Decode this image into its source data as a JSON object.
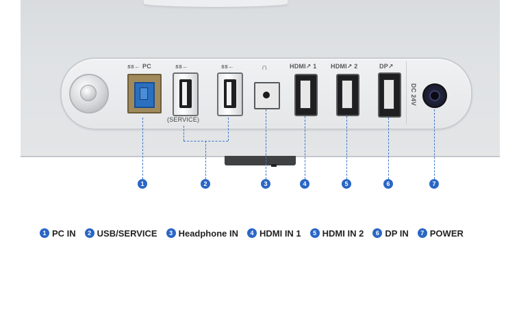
{
  "port_labels": {
    "pc": "PC",
    "usb": "SS",
    "usb_service": "(SERVICE)",
    "headphone": "∩",
    "hdmi1": "HDMI↗ 1",
    "hdmi2": "HDMI↗ 2",
    "dp": "DP↗",
    "dc": "DC 24V"
  },
  "callouts": [
    "1",
    "2",
    "3",
    "4",
    "5",
    "6",
    "7"
  ],
  "legend": [
    {
      "num": "1",
      "label": "PC IN"
    },
    {
      "num": "2",
      "label": "USB/SERVICE"
    },
    {
      "num": "3",
      "label": "Headphone IN"
    },
    {
      "num": "4",
      "label": "HDMI IN 1"
    },
    {
      "num": "5",
      "label": "HDMI IN 2"
    },
    {
      "num": "6",
      "label": "DP IN"
    },
    {
      "num": "7",
      "label": "POWER"
    }
  ],
  "colors": {
    "accent": "#2a66c5",
    "panel": "#e4e6e8",
    "usb_b": "#2b6fbf"
  }
}
